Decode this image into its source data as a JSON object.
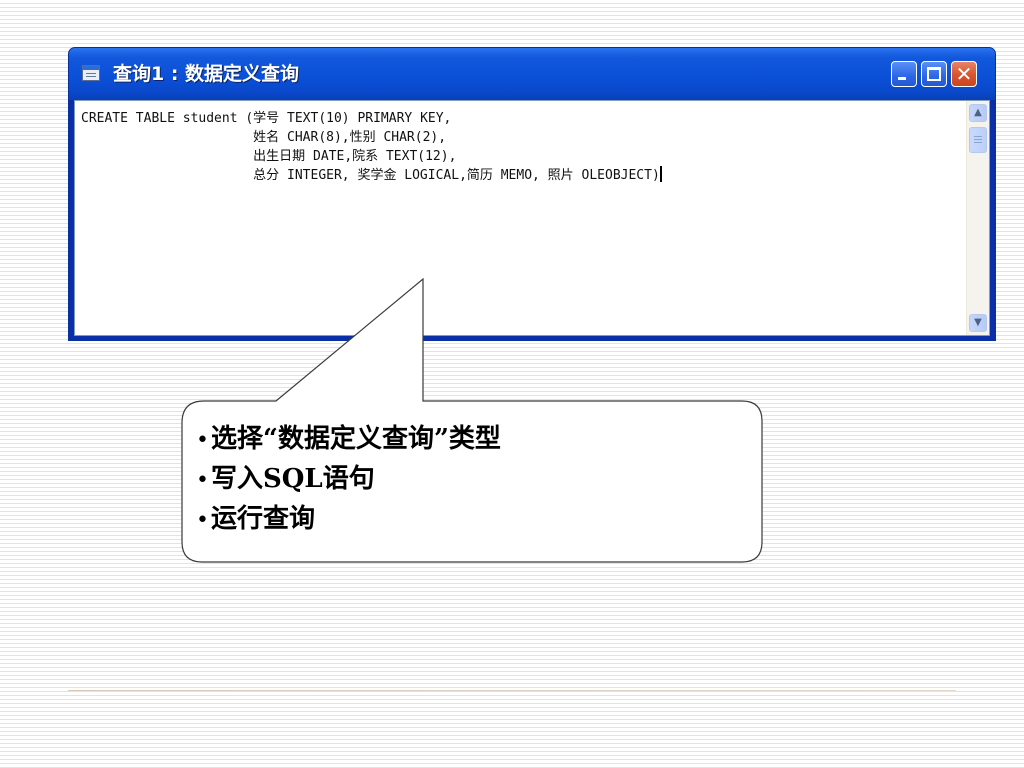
{
  "window": {
    "title": "查询1 : 数据定义查询",
    "close_glyph": "✕",
    "title_icon": "query-window-icon"
  },
  "editor": {
    "sql_lines": [
      "CREATE TABLE student (学号 TEXT(10) PRIMARY KEY,",
      "                      姓名 CHAR(8),性别 CHAR(2),",
      "                      出生日期 DATE,院系 TEXT(12),",
      "                      总分 INTEGER, 奖学金 LOGICAL,简历 MEMO, 照片 OLEOBJECT)"
    ],
    "scroll_up_glyph": "▲",
    "scroll_down_glyph": "▼"
  },
  "callout": {
    "items": [
      "选择“数据定义查询”类型",
      "写入SQL语句",
      "运行查询"
    ]
  },
  "colors": {
    "title_bar": "#0b50d8",
    "close_button": "#d9532b",
    "page_stripes": "#e3e3e3"
  }
}
